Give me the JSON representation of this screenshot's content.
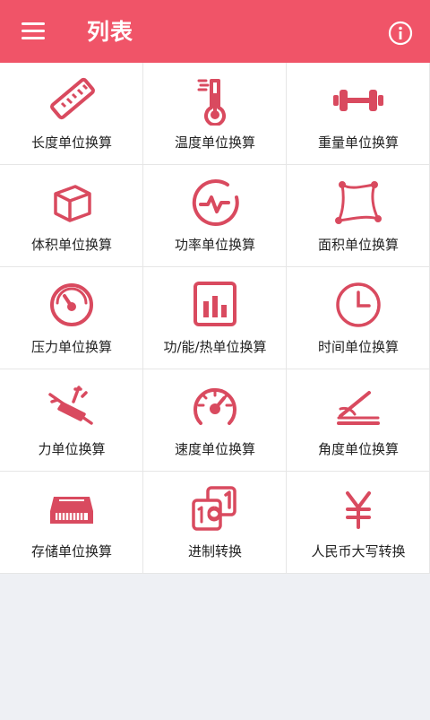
{
  "appbar": {
    "title": "列表",
    "menu_icon": "hamburger-menu-icon",
    "info_icon": "info-icon",
    "color": "#f05468"
  },
  "accent": "#d94a5f",
  "items": [
    {
      "label": "长度单位换算",
      "icon": "ruler-icon"
    },
    {
      "label": "温度单位换算",
      "icon": "thermometer-icon"
    },
    {
      "label": "重量单位换算",
      "icon": "dumbbell-icon"
    },
    {
      "label": "体积单位换算",
      "icon": "cube-icon"
    },
    {
      "label": "功率单位换算",
      "icon": "power-pulse-icon"
    },
    {
      "label": "面积单位换算",
      "icon": "area-shape-icon"
    },
    {
      "label": "压力单位换算",
      "icon": "pressure-gauge-icon"
    },
    {
      "label": "功/能/热单位换算",
      "icon": "bar-chart-icon"
    },
    {
      "label": "时间单位换算",
      "icon": "clock-icon"
    },
    {
      "label": "力单位换算",
      "icon": "force-icon"
    },
    {
      "label": "速度单位换算",
      "icon": "speedometer-icon"
    },
    {
      "label": "角度单位换算",
      "icon": "angle-icon"
    },
    {
      "label": "存储单位换算",
      "icon": "memory-chip-icon"
    },
    {
      "label": "进制转换",
      "icon": "number-base-icon"
    },
    {
      "label": "人民币大写转换",
      "icon": "yuan-icon"
    }
  ]
}
